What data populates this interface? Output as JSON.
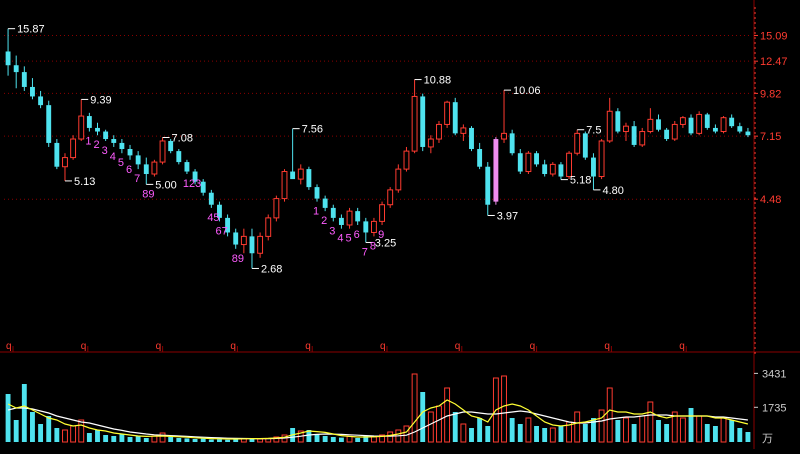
{
  "colors": {
    "background": "#000000",
    "up": "#ff3b30",
    "down": "#4fe3ef",
    "marker": "#ff5cff",
    "highlight": "#f08cf0",
    "axis_price": "#ff3b30",
    "axis_vol": "#cccccc",
    "grid": "#8a0000",
    "label": "#ffffff",
    "ma_fast": "#ffff33",
    "ma_slow": "#ffffff"
  },
  "chart_data": [
    {
      "type": "candlestick",
      "title": "",
      "y_scale": "log",
      "y_ticks": [
        "15.09",
        "12.47",
        "9.82",
        "7.15",
        "4.48"
      ],
      "ylim": [
        1.6,
        18.5
      ],
      "grid": "dotted",
      "period_marker": "q",
      "period_marker_count": 10,
      "candles": [
        [
          13.4,
          15.87,
          11.2,
          12.1
        ],
        [
          12.1,
          13.0,
          10.2,
          11.5
        ],
        [
          11.5,
          12.0,
          10.0,
          10.3
        ],
        [
          10.3,
          11.0,
          9.4,
          9.6
        ],
        [
          9.6,
          10.0,
          8.8,
          9.0
        ],
        [
          9.0,
          9.3,
          6.6,
          6.8
        ],
        [
          6.8,
          7.0,
          5.6,
          5.7
        ],
        [
          5.7,
          6.3,
          5.13,
          6.1
        ],
        [
          6.1,
          7.2,
          6.0,
          7.0
        ],
        [
          7.0,
          9.39,
          6.9,
          8.3
        ],
        [
          8.3,
          8.5,
          7.4,
          7.6
        ],
        [
          7.6,
          7.9,
          7.2,
          7.4
        ],
        [
          7.4,
          7.5,
          6.9,
          7.0
        ],
        [
          7.0,
          7.2,
          6.6,
          6.8
        ],
        [
          6.8,
          7.0,
          6.3,
          6.5
        ],
        [
          6.5,
          6.7,
          6.0,
          6.2
        ],
        [
          6.2,
          6.4,
          5.6,
          5.8
        ],
        [
          5.8,
          6.1,
          5.0,
          5.4
        ],
        [
          5.4,
          6.0,
          5.3,
          5.9
        ],
        [
          5.9,
          7.08,
          5.8,
          6.9
        ],
        [
          6.9,
          7.0,
          6.3,
          6.4
        ],
        [
          6.4,
          6.5,
          5.8,
          5.9
        ],
        [
          5.9,
          6.0,
          5.4,
          5.5
        ],
        [
          5.5,
          5.6,
          5.0,
          5.1
        ],
        [
          5.1,
          5.2,
          4.6,
          4.7
        ],
        [
          4.7,
          4.8,
          4.2,
          4.3
        ],
        [
          4.3,
          4.4,
          3.8,
          3.9
        ],
        [
          3.9,
          4.0,
          3.4,
          3.5
        ],
        [
          3.5,
          3.6,
          3.1,
          3.2
        ],
        [
          3.2,
          3.6,
          3.0,
          3.4
        ],
        [
          3.4,
          3.6,
          2.68,
          3.0
        ],
        [
          3.0,
          3.5,
          2.9,
          3.4
        ],
        [
          3.4,
          4.0,
          3.3,
          3.9
        ],
        [
          3.9,
          4.6,
          3.8,
          4.5
        ],
        [
          4.5,
          5.6,
          4.4,
          5.5
        ],
        [
          5.5,
          7.56,
          5.3,
          5.2
        ],
        [
          5.2,
          5.8,
          5.0,
          5.6
        ],
        [
          5.6,
          5.7,
          4.8,
          4.9
        ],
        [
          4.9,
          5.0,
          4.4,
          4.5
        ],
        [
          4.5,
          4.6,
          4.1,
          4.2
        ],
        [
          4.2,
          4.3,
          3.8,
          3.9
        ],
        [
          3.9,
          4.0,
          3.6,
          3.7
        ],
        [
          3.7,
          4.2,
          3.6,
          4.1
        ],
        [
          4.1,
          4.2,
          3.7,
          3.8
        ],
        [
          3.8,
          3.9,
          3.25,
          3.5
        ],
        [
          3.5,
          3.9,
          3.4,
          3.8
        ],
        [
          3.8,
          4.4,
          3.7,
          4.3
        ],
        [
          4.3,
          4.9,
          4.2,
          4.8
        ],
        [
          4.8,
          5.8,
          4.7,
          5.6
        ],
        [
          5.6,
          6.6,
          5.5,
          6.4
        ],
        [
          6.4,
          10.88,
          6.3,
          9.6
        ],
        [
          9.6,
          9.8,
          6.4,
          6.6
        ],
        [
          6.6,
          7.2,
          6.3,
          7.0
        ],
        [
          7.0,
          8.0,
          6.8,
          7.8
        ],
        [
          7.8,
          9.3,
          7.6,
          9.2
        ],
        [
          9.2,
          9.5,
          7.2,
          7.3
        ],
        [
          7.3,
          7.8,
          6.9,
          7.6
        ],
        [
          7.6,
          7.7,
          6.4,
          6.5
        ],
        [
          6.5,
          6.8,
          5.6,
          5.7
        ],
        [
          5.7,
          5.9,
          3.97,
          4.3
        ],
        [
          4.4,
          7.1,
          4.3,
          7.0
        ],
        [
          7.0,
          10.06,
          6.8,
          7.3
        ],
        [
          7.3,
          7.5,
          6.2,
          6.3
        ],
        [
          6.3,
          6.5,
          5.4,
          5.5
        ],
        [
          5.5,
          6.4,
          5.4,
          6.3
        ],
        [
          6.3,
          6.4,
          5.7,
          5.8
        ],
        [
          5.8,
          6.0,
          5.3,
          5.4
        ],
        [
          5.4,
          5.9,
          5.3,
          5.8
        ],
        [
          5.8,
          5.9,
          5.18,
          5.3
        ],
        [
          5.3,
          6.4,
          5.2,
          6.3
        ],
        [
          6.3,
          7.5,
          6.2,
          7.3
        ],
        [
          7.3,
          7.4,
          6.0,
          6.1
        ],
        [
          6.1,
          6.3,
          4.8,
          5.3
        ],
        [
          5.3,
          7.0,
          5.2,
          6.9
        ],
        [
          6.9,
          9.5,
          6.8,
          8.6
        ],
        [
          8.6,
          8.8,
          7.3,
          7.4
        ],
        [
          7.4,
          7.9,
          6.9,
          7.7
        ],
        [
          7.7,
          8.0,
          6.6,
          6.7
        ],
        [
          6.7,
          7.6,
          6.6,
          7.4
        ],
        [
          7.4,
          8.8,
          7.3,
          8.1
        ],
        [
          8.1,
          8.4,
          7.4,
          7.5
        ],
        [
          7.5,
          7.6,
          6.9,
          7.0
        ],
        [
          7.0,
          8.0,
          6.9,
          7.8
        ],
        [
          7.8,
          8.3,
          7.6,
          8.2
        ],
        [
          8.2,
          8.4,
          7.2,
          7.3
        ],
        [
          7.3,
          8.6,
          7.2,
          8.4
        ],
        [
          8.4,
          8.5,
          7.5,
          7.6
        ],
        [
          7.6,
          7.8,
          7.3,
          7.4
        ],
        [
          7.4,
          8.3,
          7.3,
          8.2
        ],
        [
          8.2,
          8.4,
          7.6,
          7.7
        ],
        [
          7.7,
          7.9,
          7.3,
          7.4
        ],
        [
          7.4,
          7.6,
          7.1,
          7.2
        ]
      ],
      "highlight_candle_index": 60,
      "price_labels": [
        {
          "i": 0,
          "text": "15.87",
          "at": "high"
        },
        {
          "i": 7,
          "text": "5.13",
          "at": "low"
        },
        {
          "i": 9,
          "text": "9.39",
          "at": "high"
        },
        {
          "i": 17,
          "text": "5.00",
          "at": "low"
        },
        {
          "i": 19,
          "text": "7.08",
          "at": "high"
        },
        {
          "i": 30,
          "text": "2.68",
          "at": "low"
        },
        {
          "i": 35,
          "text": "7.56",
          "at": "high"
        },
        {
          "i": 44,
          "text": "3.25",
          "at": "low"
        },
        {
          "i": 50,
          "text": "10.88",
          "at": "high"
        },
        {
          "i": 59,
          "text": "3.97",
          "at": "low"
        },
        {
          "i": 61,
          "text": "10.06",
          "at": "high"
        },
        {
          "i": 68,
          "text": "5.18",
          "at": "low"
        },
        {
          "i": 70,
          "text": "7.5",
          "at": "high"
        },
        {
          "i": 72,
          "text": "4.80",
          "at": "low"
        }
      ],
      "seq_labels": [
        {
          "i": 10,
          "text": "1"
        },
        {
          "i": 11,
          "text": "2"
        },
        {
          "i": 12,
          "text": "3"
        },
        {
          "i": 13,
          "text": "4"
        },
        {
          "i": 14,
          "text": "5"
        },
        {
          "i": 15,
          "text": "6"
        },
        {
          "i": 16,
          "text": "7"
        },
        {
          "i": 17,
          "text": "89"
        },
        {
          "i": 22,
          "text": "123"
        },
        {
          "i": 25,
          "text": "45"
        },
        {
          "i": 26,
          "text": "67"
        },
        {
          "i": 28,
          "text": "89"
        },
        {
          "i": 38,
          "text": "1"
        },
        {
          "i": 39,
          "text": "2"
        },
        {
          "i": 40,
          "text": "3"
        },
        {
          "i": 41,
          "text": "4"
        },
        {
          "i": 42,
          "text": "5"
        },
        {
          "i": 43,
          "text": "6"
        },
        {
          "i": 44,
          "text": "7"
        },
        {
          "i": 45,
          "text": "8"
        },
        {
          "i": 46,
          "text": "9"
        }
      ]
    },
    {
      "type": "bar",
      "title": "",
      "y_ticks": [
        "3431",
        "1735"
      ],
      "unit": "万",
      "ylim": [
        0,
        3600
      ],
      "volumes": [
        2400,
        1100,
        2900,
        1500,
        900,
        1300,
        700,
        600,
        800,
        1100,
        450,
        600,
        350,
        300,
        400,
        250,
        300,
        200,
        300,
        450,
        250,
        200,
        180,
        150,
        170,
        120,
        130,
        110,
        140,
        160,
        200,
        150,
        180,
        250,
        350,
        700,
        550,
        600,
        400,
        300,
        250,
        220,
        280,
        200,
        300,
        250,
        350,
        500,
        600,
        800,
        3400,
        2500,
        1500,
        1800,
        2700,
        1500,
        900,
        700,
        1200,
        800,
        3200,
        3300,
        1200,
        900,
        1200,
        800,
        700,
        700,
        800,
        1000,
        1500,
        900,
        1200,
        1600,
        2700,
        1100,
        1200,
        900,
        1300,
        2000,
        1100,
        900,
        1500,
        1200,
        1700,
        1300,
        900,
        800,
        1200,
        1100,
        700,
        500
      ],
      "ma5": [
        1900,
        1700,
        1800,
        1600,
        1400,
        1200,
        1100,
        900,
        800,
        850,
        700,
        600,
        550,
        450,
        400,
        350,
        300,
        280,
        290,
        300,
        280,
        260,
        240,
        210,
        190,
        170,
        160,
        150,
        150,
        160,
        170,
        170,
        180,
        200,
        240,
        360,
        450,
        550,
        520,
        480,
        400,
        320,
        280,
        250,
        250,
        260,
        280,
        330,
        400,
        500,
        1000,
        1500,
        1700,
        1800,
        2100,
        1900,
        1600,
        1300,
        1200,
        1000,
        1600,
        1800,
        1900,
        1800,
        1600,
        1300,
        1000,
        850,
        800,
        850,
        950,
        1000,
        1100,
        1200,
        1600,
        1500,
        1500,
        1400,
        1400,
        1500,
        1300,
        1200,
        1300,
        1300,
        1300,
        1300,
        1300,
        1200,
        1200,
        1100,
        1000,
        900
      ],
      "ma10": [
        1600,
        1700,
        1700,
        1650,
        1550,
        1450,
        1300,
        1200,
        1100,
        1000,
        950,
        850,
        750,
        650,
        580,
        500,
        450,
        400,
        360,
        340,
        320,
        300,
        280,
        260,
        240,
        220,
        205,
        190,
        180,
        175,
        170,
        170,
        172,
        180,
        200,
        240,
        290,
        350,
        380,
        400,
        390,
        380,
        360,
        340,
        320,
        300,
        290,
        295,
        310,
        340,
        500,
        700,
        900,
        1100,
        1300,
        1400,
        1500,
        1500,
        1450,
        1400,
        1400,
        1450,
        1500,
        1550,
        1500,
        1400,
        1300,
        1200,
        1100,
        1000,
        950,
        950,
        1000,
        1050,
        1150,
        1200,
        1250,
        1250,
        1300,
        1350,
        1350,
        1350,
        1300,
        1300,
        1300,
        1300,
        1300,
        1250,
        1250,
        1200,
        1150,
        1100
      ]
    }
  ]
}
